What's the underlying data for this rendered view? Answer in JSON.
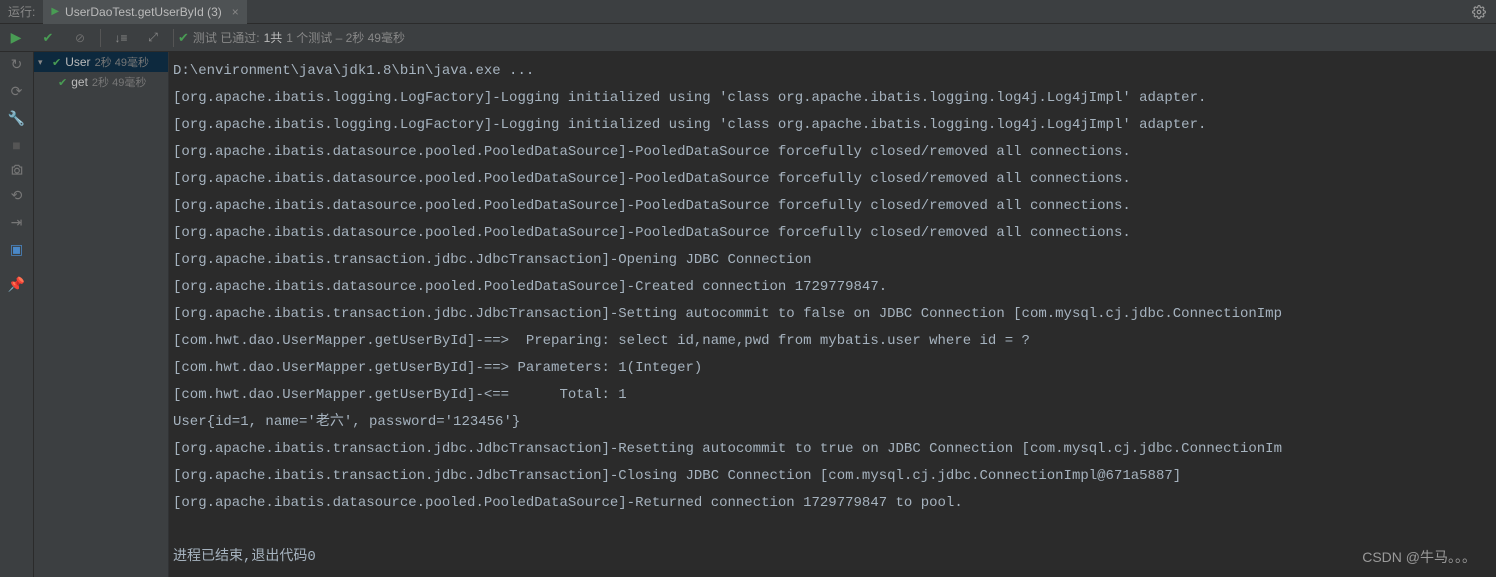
{
  "header": {
    "run_label": "运行:",
    "tab_title": "UserDaoTest.getUserById (3)"
  },
  "toolbar": {
    "status_prefix": "测试 已通过:",
    "status_count": "1共",
    "status_suffix": "1 个测试 – 2秒 49毫秒"
  },
  "tree": {
    "root": {
      "name": "User",
      "time": "2秒 49毫秒"
    },
    "child": {
      "name": "get",
      "time": "2秒 49毫秒"
    }
  },
  "console": {
    "lines": [
      "D:\\environment\\java\\jdk1.8\\bin\\java.exe ...",
      "[org.apache.ibatis.logging.LogFactory]-Logging initialized using 'class org.apache.ibatis.logging.log4j.Log4jImpl' adapter.",
      "[org.apache.ibatis.logging.LogFactory]-Logging initialized using 'class org.apache.ibatis.logging.log4j.Log4jImpl' adapter.",
      "[org.apache.ibatis.datasource.pooled.PooledDataSource]-PooledDataSource forcefully closed/removed all connections.",
      "[org.apache.ibatis.datasource.pooled.PooledDataSource]-PooledDataSource forcefully closed/removed all connections.",
      "[org.apache.ibatis.datasource.pooled.PooledDataSource]-PooledDataSource forcefully closed/removed all connections.",
      "[org.apache.ibatis.datasource.pooled.PooledDataSource]-PooledDataSource forcefully closed/removed all connections.",
      "[org.apache.ibatis.transaction.jdbc.JdbcTransaction]-Opening JDBC Connection",
      "[org.apache.ibatis.datasource.pooled.PooledDataSource]-Created connection 1729779847.",
      "[org.apache.ibatis.transaction.jdbc.JdbcTransaction]-Setting autocommit to false on JDBC Connection [com.mysql.cj.jdbc.ConnectionImp",
      "[com.hwt.dao.UserMapper.getUserById]-==>  Preparing: select id,name,pwd from mybatis.user where id = ?",
      "[com.hwt.dao.UserMapper.getUserById]-==> Parameters: 1(Integer)",
      "[com.hwt.dao.UserMapper.getUserById]-<==      Total: 1",
      "User{id=1, name='老六', password='123456'}",
      "[org.apache.ibatis.transaction.jdbc.JdbcTransaction]-Resetting autocommit to true on JDBC Connection [com.mysql.cj.jdbc.ConnectionIm",
      "[org.apache.ibatis.transaction.jdbc.JdbcTransaction]-Closing JDBC Connection [com.mysql.cj.jdbc.ConnectionImpl@671a5887]",
      "[org.apache.ibatis.datasource.pooled.PooledDataSource]-Returned connection 1729779847 to pool.",
      "",
      "进程已结束,退出代码0"
    ]
  },
  "watermark": "CSDN @牛马。。。"
}
